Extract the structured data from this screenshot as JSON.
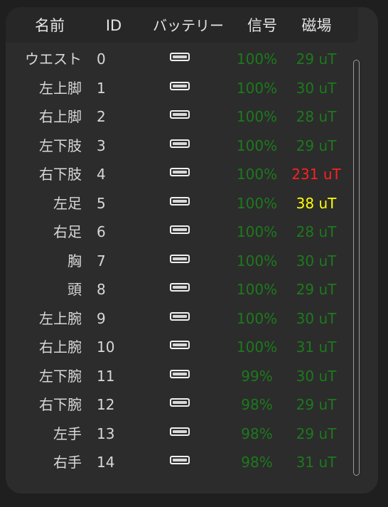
{
  "header": {
    "name": "名前",
    "id": "ID",
    "battery": "バッテリー",
    "signal": "信号",
    "magnetic": "磁場"
  },
  "colors": {
    "ok": "#1c7a1c",
    "warning": "#ffff00",
    "error": "#ff2020"
  },
  "rows": [
    {
      "name": "ウエスト",
      "id": "0",
      "signal": "100%",
      "mag": "29 uT",
      "mag_status": "ok",
      "battery_icon": "battery-icon",
      "battery_level": 1.0
    },
    {
      "name": "左上脚",
      "id": "1",
      "signal": "100%",
      "mag": "30 uT",
      "mag_status": "ok",
      "battery_icon": "battery-icon",
      "battery_level": 1.0
    },
    {
      "name": "右上脚",
      "id": "2",
      "signal": "100%",
      "mag": "28 uT",
      "mag_status": "ok",
      "battery_icon": "battery-icon",
      "battery_level": 1.0
    },
    {
      "name": "左下肢",
      "id": "3",
      "signal": "100%",
      "mag": "29 uT",
      "mag_status": "ok",
      "battery_icon": "battery-icon",
      "battery_level": 1.0
    },
    {
      "name": "右下肢",
      "id": "4",
      "signal": "100%",
      "mag": "231 uT",
      "mag_status": "error",
      "battery_icon": "battery-icon",
      "battery_level": 1.0
    },
    {
      "name": "左足",
      "id": "5",
      "signal": "100%",
      "mag": "38 uT",
      "mag_status": "warning",
      "battery_icon": "battery-icon",
      "battery_level": 1.0
    },
    {
      "name": "右足",
      "id": "6",
      "signal": "100%",
      "mag": "28 uT",
      "mag_status": "ok",
      "battery_icon": "battery-icon",
      "battery_level": 1.0
    },
    {
      "name": "胸",
      "id": "7",
      "signal": "100%",
      "mag": "30 uT",
      "mag_status": "ok",
      "battery_icon": "battery-icon",
      "battery_level": 1.0
    },
    {
      "name": "頭",
      "id": "8",
      "signal": "100%",
      "mag": "29 uT",
      "mag_status": "ok",
      "battery_icon": "battery-icon",
      "battery_level": 1.0
    },
    {
      "name": "左上腕",
      "id": "9",
      "signal": "100%",
      "mag": "30 uT",
      "mag_status": "ok",
      "battery_icon": "battery-icon",
      "battery_level": 1.0
    },
    {
      "name": "右上腕",
      "id": "10",
      "signal": "100%",
      "mag": "31 uT",
      "mag_status": "ok",
      "battery_icon": "battery-icon",
      "battery_level": 1.0
    },
    {
      "name": "左下腕",
      "id": "11",
      "signal": "99%",
      "mag": "30 uT",
      "mag_status": "ok",
      "battery_icon": "battery-icon",
      "battery_level": 1.0
    },
    {
      "name": "右下腕",
      "id": "12",
      "signal": "98%",
      "mag": "29 uT",
      "mag_status": "ok",
      "battery_icon": "battery-icon",
      "battery_level": 1.0
    },
    {
      "name": "左手",
      "id": "13",
      "signal": "98%",
      "mag": "29 uT",
      "mag_status": "ok",
      "battery_icon": "battery-icon",
      "battery_level": 1.0
    },
    {
      "name": "右手",
      "id": "14",
      "signal": "98%",
      "mag": "31 uT",
      "mag_status": "ok",
      "battery_icon": "battery-icon",
      "battery_level": 1.0
    }
  ]
}
